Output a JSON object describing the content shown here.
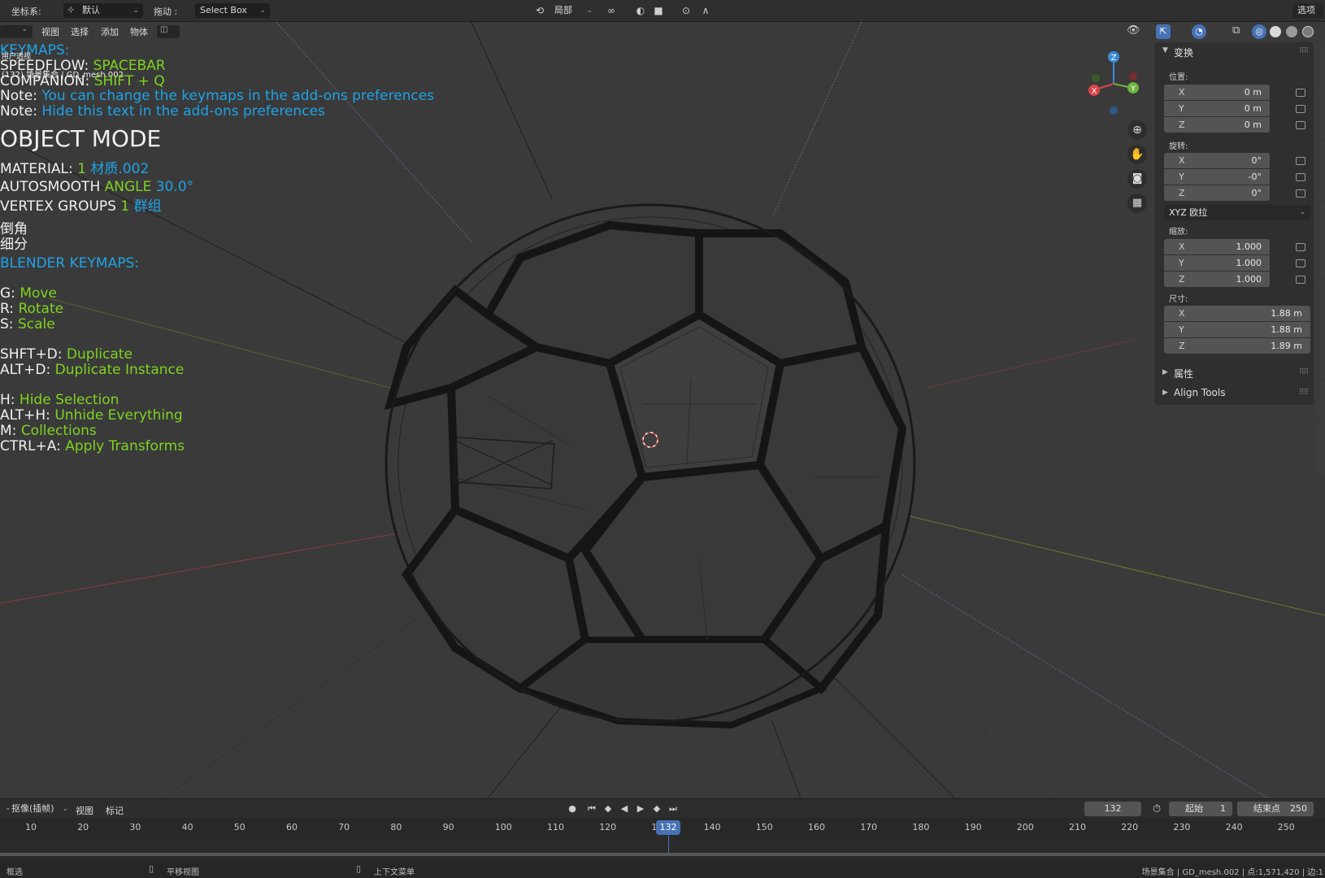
{
  "header": {
    "coord_label": "坐标系:",
    "coord_value": "默认",
    "drag_label": "拖动 :",
    "drag_value": "Select Box",
    "pivot_value": "局部",
    "options_label": "选项"
  },
  "menus": [
    "视图",
    "选择",
    "添加",
    "物体"
  ],
  "overlay": {
    "keymaps_title": "KEYMAPS:",
    "view_name": "用户透视",
    "collection_info": "(132) 场景集合 | GD_mesh.002",
    "speedflow_key": "SPEEDFLOW:",
    "speedflow_val": "SPACEBAR",
    "companion_key": "COMPANION:",
    "companion_val": "SHIFT + Q",
    "note_label": "Note:",
    "note1": "You can change the keymaps in the add-ons preferences",
    "note2": "Hide this text in the add-ons preferences",
    "mode": "OBJECT MODE",
    "material_key": "MATERIAL:",
    "material_count": "1",
    "material_name": "材质.002",
    "autosmooth_key": "AUTOSMOOTH",
    "autosmooth_angle_key": "ANGLE",
    "autosmooth_angle": "30.0°",
    "vgroups_key": "VERTEX GROUPS",
    "vgroups_count": "1",
    "vgroups_name": "群组",
    "mod1": "倒角",
    "mod2": "细分",
    "blender_keymaps": "BLENDER KEYMAPS:",
    "shortcuts": [
      {
        "key": "G:",
        "action": "Move"
      },
      {
        "key": "R:",
        "action": "Rotate"
      },
      {
        "key": "S:",
        "action": "Scale"
      },
      {
        "key": "SHFT+D:",
        "action": "Duplicate"
      },
      {
        "key": "ALT+D:",
        "action": "Duplicate Instance"
      },
      {
        "key": "H:",
        "action": "Hide Selection"
      },
      {
        "key": "ALT+H:",
        "action": "Unhide Everything"
      },
      {
        "key": "M:",
        "action": "Collections"
      },
      {
        "key": "CTRL+A:",
        "action": "Apply Transforms"
      }
    ]
  },
  "gizmo": {
    "x": "X",
    "y": "Y",
    "z": "Z"
  },
  "npanel": {
    "transform_title": "变换",
    "location_label": "位置:",
    "location": [
      {
        "axis": "X",
        "value": "0 m"
      },
      {
        "axis": "Y",
        "value": "0 m"
      },
      {
        "axis": "Z",
        "value": "0 m"
      }
    ],
    "rotation_label": "旋转:",
    "rotation": [
      {
        "axis": "X",
        "value": "0°"
      },
      {
        "axis": "Y",
        "value": "-0°"
      },
      {
        "axis": "Z",
        "value": "0°"
      }
    ],
    "rotation_mode": "XYZ 欧拉",
    "scale_label": "缩放:",
    "scale": [
      {
        "axis": "X",
        "value": "1.000"
      },
      {
        "axis": "Y",
        "value": "1.000"
      },
      {
        "axis": "Z",
        "value": "1.000"
      }
    ],
    "dims_label": "尺寸:",
    "dims": [
      {
        "axis": "X",
        "value": "1.88 m"
      },
      {
        "axis": "Y",
        "value": "1.88 m"
      },
      {
        "axis": "Z",
        "value": "1.89 m"
      }
    ],
    "properties_title": "属性",
    "align_tools_title": "Align Tools"
  },
  "timeline": {
    "keying_label": "抠像(插帧)",
    "view_label": "视图",
    "marker_label": "标记",
    "current_frame": "132",
    "start_label": "起始",
    "start_value": "1",
    "end_label": "结束点",
    "end_value": "250",
    "ticks": [
      "10",
      "20",
      "30",
      "40",
      "50",
      "60",
      "70",
      "80",
      "90",
      "100",
      "110",
      "120",
      "13",
      "140",
      "150",
      "160",
      "170",
      "180",
      "190",
      "200",
      "210",
      "220",
      "230",
      "240",
      "250"
    ],
    "playhead": "132"
  },
  "statusbar": {
    "left": "框选",
    "middle": "平移视图",
    "right": "上下文菜单",
    "info": "场景集合 | GD_mesh.002 | 点:1,571,420 | 边:1"
  },
  "colors": {
    "green": "#7ed321",
    "blue": "#1ea3e6",
    "accent": "#4772b3"
  }
}
